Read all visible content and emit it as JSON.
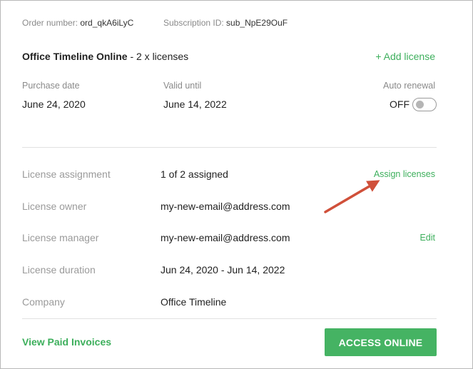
{
  "order": {
    "order_number_label": "Order number:",
    "order_number_value": "ord_qkA6iLyC",
    "subscription_label": "Subscription ID:",
    "subscription_value": "sub_NpE29OuF"
  },
  "product": {
    "name": "Office Timeline Online",
    "licenses_text": " - 2 x licenses",
    "add_license_label": "+ Add license"
  },
  "dates": {
    "purchase_label": "Purchase date",
    "purchase_value": "June 24, 2020",
    "valid_label": "Valid until",
    "valid_value": "June 14, 2022",
    "auto_renewal_label": "Auto renewal",
    "auto_renewal_state": "OFF",
    "auto_renewal_on": false
  },
  "details": {
    "assignment_label": "License assignment",
    "assignment_value": "1 of 2 assigned",
    "assign_link": "Assign licenses",
    "owner_label": "License owner",
    "owner_value": "my-new-email@address.com",
    "manager_label": "License manager",
    "manager_value": "my-new-email@address.com",
    "edit_link": "Edit",
    "duration_label": "License duration",
    "duration_value": "Jun 24, 2020 - Jun 14, 2022",
    "company_label": "Company",
    "company_value": "Office Timeline"
  },
  "footer": {
    "invoices_link": "View Paid Invoices",
    "access_button": "ACCESS ONLINE"
  },
  "colors": {
    "accent_green": "#3daf5c",
    "button_green": "#45b363",
    "annotation_arrow": "#d0503a"
  }
}
